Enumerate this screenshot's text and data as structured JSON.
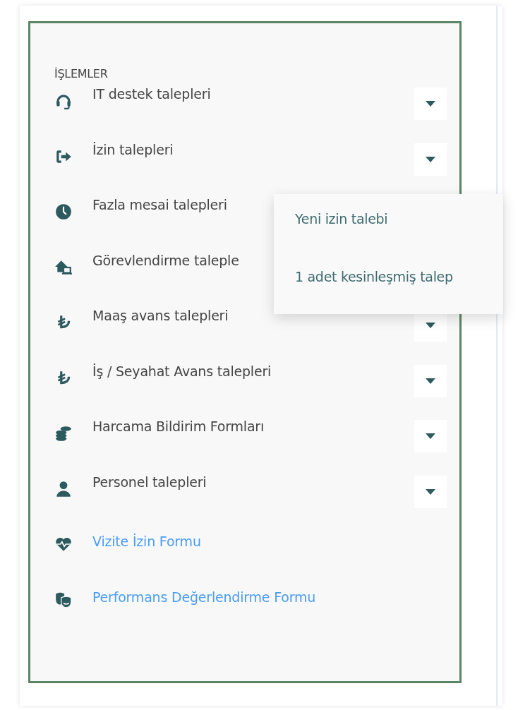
{
  "panel": {
    "heading": "İŞLEMLER",
    "items": [
      {
        "kind": "dropdown",
        "label": "IT destek talepleri"
      },
      {
        "kind": "dropdown",
        "label": "İzin talepleri",
        "menu": [
          "Yeni izin talebi",
          "1 adet kesinleşmiş talep"
        ]
      },
      {
        "kind": "item",
        "label": "Fazla mesai talepleri"
      },
      {
        "kind": "item",
        "label": "Görevlendirme taleple"
      },
      {
        "kind": "dropdown",
        "label": "Maaş avans talepleri"
      },
      {
        "kind": "dropdown",
        "label": "İş / Seyahat Avans talepleri"
      },
      {
        "kind": "dropdown",
        "label": "Harcama Bildirim Formları"
      },
      {
        "kind": "dropdown",
        "label": "Personel talepleri"
      },
      {
        "kind": "link",
        "label": "Vizite İzin Formu"
      },
      {
        "kind": "link",
        "label": "Performans Değerlendirme Formu"
      }
    ]
  }
}
